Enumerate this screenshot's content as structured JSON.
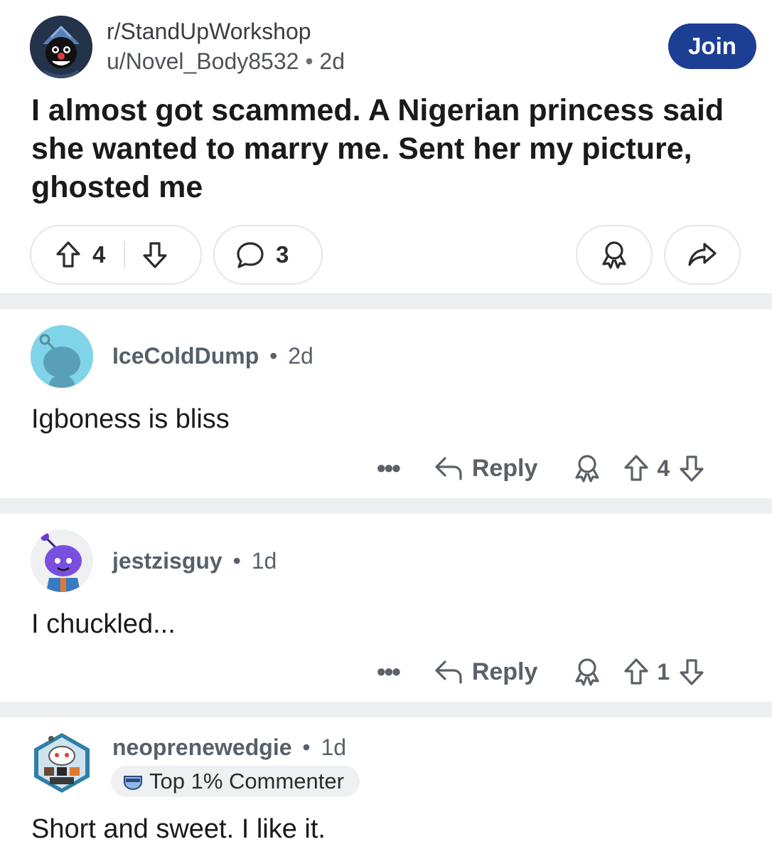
{
  "post": {
    "subreddit": "r/StandUpWorkshop",
    "author": "u/Novel_Body8532",
    "age": "2d",
    "join_label": "Join",
    "title": "I almost got scammed. A Nigerian princess said she wanted to marry me. Sent her my picture, ghosted me",
    "votes": "4",
    "comments": "3"
  },
  "comments": [
    {
      "username": "IceColdDump",
      "age": "2d",
      "body": "Igboness is bliss",
      "more": "•••",
      "reply_label": "Reply",
      "votes": "4"
    },
    {
      "username": "jestzisguy",
      "age": "1d",
      "body": "I chuckled...",
      "more": "•••",
      "reply_label": "Reply",
      "votes": "1"
    },
    {
      "username": "neoprenewedgie",
      "age": "1d",
      "flair": "Top 1% Commenter",
      "body": "Short and sweet. I like it."
    }
  ],
  "separator": "•",
  "colors": {
    "join_button": "#1c3f94",
    "divider": "#edeff1",
    "meta_text": "#576069"
  },
  "icons": [
    "clown-avatar-icon",
    "upvote-icon",
    "downvote-icon",
    "comment-icon",
    "award-icon",
    "share-icon",
    "reply-icon",
    "snoo-avatar-icon",
    "commenter-badge-icon"
  ]
}
